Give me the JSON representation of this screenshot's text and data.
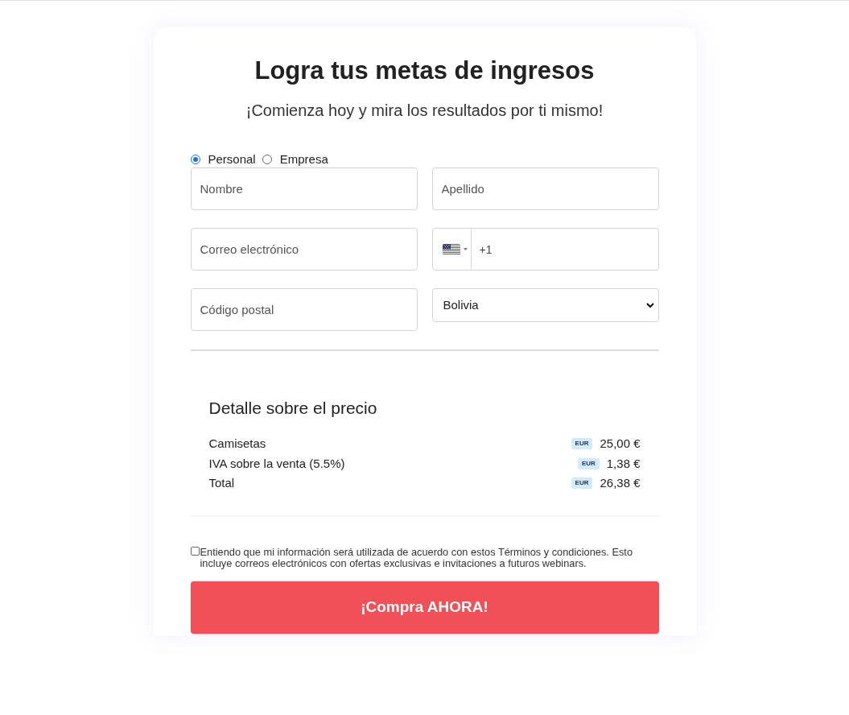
{
  "heading": {
    "title": "Logra tus metas de ingresos",
    "subtitle": "¡Comienza hoy y mira los resultados por ti mismo!"
  },
  "account_type": [
    {
      "label": "Personal",
      "selected": true
    },
    {
      "label": "Empresa",
      "selected": false
    }
  ],
  "fields": [
    {
      "kind": "text",
      "placeholder": "Nombre"
    },
    {
      "kind": "text",
      "placeholder": "Apellido"
    },
    {
      "kind": "text",
      "placeholder": "Correo electrónico"
    },
    {
      "kind": "phone",
      "value": "+1"
    },
    {
      "kind": "text",
      "placeholder": "Código postal"
    },
    {
      "kind": "select",
      "value": "Bolivia"
    }
  ],
  "price_detail": {
    "title": "Detalle sobre el precio",
    "rows": [
      {
        "label": "Camisetas",
        "currency": "EUR",
        "amount": "25,00 €"
      },
      {
        "label": "IVA sobre la venta (5.5%)",
        "currency": "EUR",
        "amount": "1,38 €"
      },
      {
        "label": "Total",
        "currency": "EUR",
        "amount": "26,38 €"
      }
    ]
  },
  "consent": {
    "checked": false,
    "text": "Entiendo que mi información será utilizada de acuerdo con estos Términos y condiciones. Esto incluye correos electrónicos con ofertas exclusivas e invitaciones a futuros webinars."
  },
  "submit_button": "¡Compra AHORA!"
}
